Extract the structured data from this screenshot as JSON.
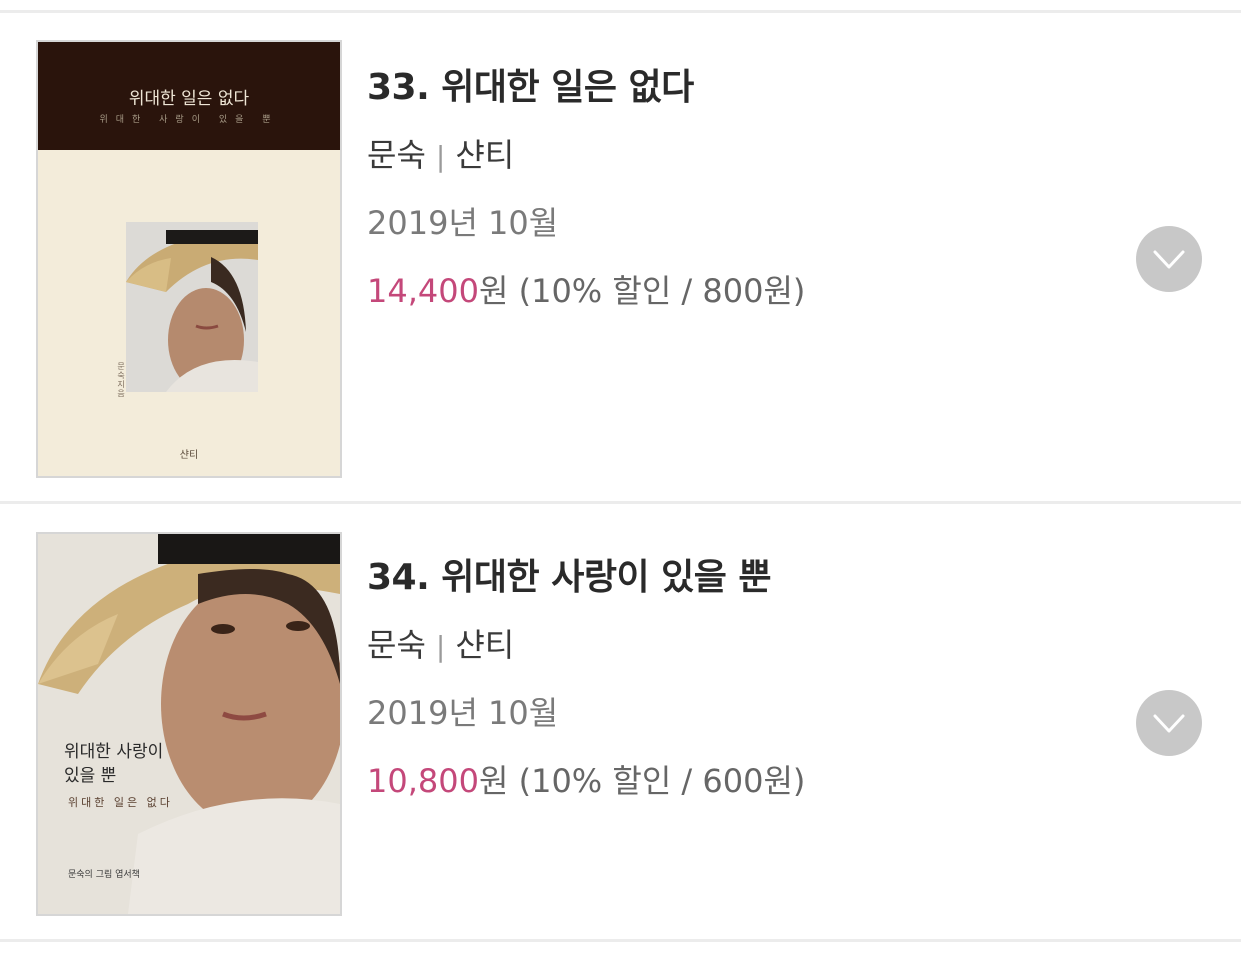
{
  "items": [
    {
      "title": "33. 위대한 일은 없다",
      "author": "문숙",
      "publisher": "샨티",
      "date": "2019년 10월",
      "price": "14,400",
      "price_unit": "원",
      "discount": " (10% 할인 / 800원)",
      "cover": {
        "title": "위대한 일은 없다",
        "subtitle": "위대한 사랑이 있을 뿐",
        "author_vertical": "문숙 지음",
        "publisher": "샨티"
      }
    },
    {
      "title": "34. 위대한 사랑이 있을 뿐",
      "author": "문숙",
      "publisher": "샨티",
      "date": "2019년 10월",
      "price": "10,800",
      "price_unit": "원",
      "discount": " (10% 할인 / 600원)",
      "cover": {
        "title_line1": "위대한 사랑이",
        "title_line2": "있을 뿐",
        "subtitle": "위대한 일은 없다",
        "footer": "문숙의 그림 엽서책"
      }
    }
  ],
  "icons": {
    "expand": "chevron-down-icon"
  },
  "colors": {
    "price_accent": "#c4487a",
    "divider": "#ececec",
    "expand_button": "#c8c8c8"
  }
}
